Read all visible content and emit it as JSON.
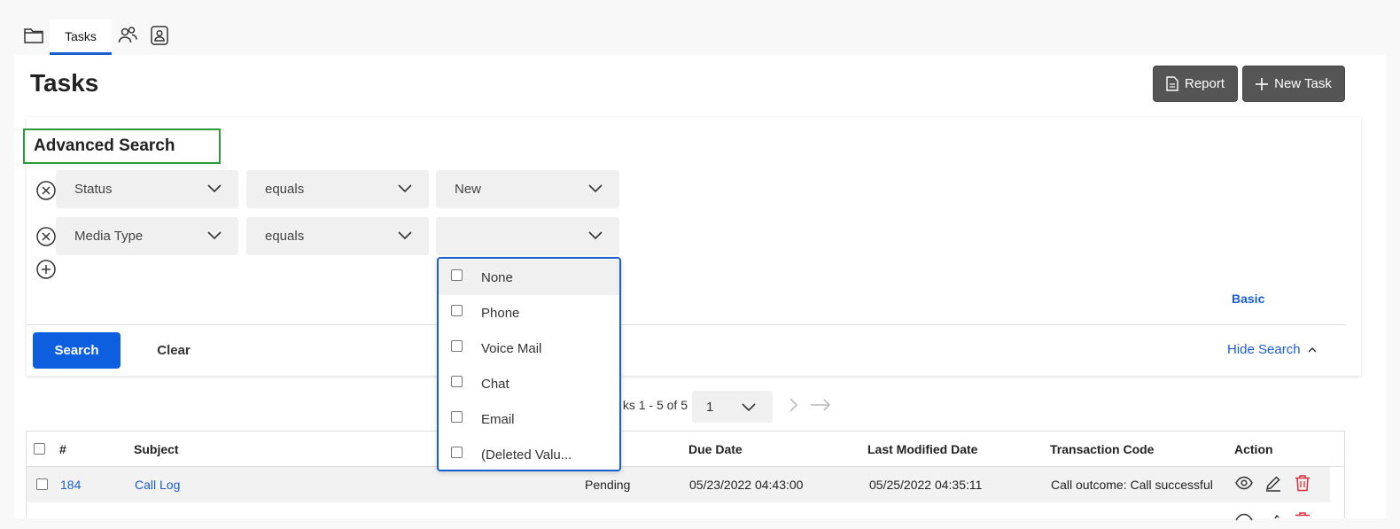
{
  "tabs": {
    "active_label": "Tasks",
    "icons": [
      "folder-icon",
      "users-icon",
      "contacts-icon"
    ]
  },
  "page": {
    "title": "Tasks",
    "report_label": "Report",
    "new_task_label": "New Task"
  },
  "advanced_search": {
    "title": "Advanced Search",
    "rows": [
      {
        "field": "Status",
        "operator": "equals",
        "value": "New"
      },
      {
        "field": "Media Type",
        "operator": "equals",
        "value": ""
      }
    ],
    "dropdown_options": [
      "None",
      "Phone",
      "Voice Mail",
      "Chat",
      "Email",
      "(Deleted Valu..."
    ],
    "basic_link": "Basic",
    "search_label": "Search",
    "clear_label": "Clear",
    "hide_search_label": "Hide Search"
  },
  "pager": {
    "summary": "ks 1 - 5 of 5",
    "page": "1"
  },
  "table": {
    "headers": {
      "num": "#",
      "subject": "Subject",
      "due_date": "Due Date",
      "last_modified": "Last Modified Date",
      "transaction_code": "Transaction Code",
      "action": "Action"
    },
    "rows": [
      {
        "num": "184",
        "subject": "Call Log",
        "status": "Pending",
        "due_date": "05/23/2022 04:43:00",
        "last_modified": "05/25/2022 04:35:11",
        "transaction_code": "Call outcome: Call successful"
      }
    ]
  },
  "colors": {
    "accent": "#1a5fd0",
    "primary_button": "#0d5fe0",
    "dark_button": "#555555",
    "highlight_border": "#2a9a3a",
    "delete": "#d9303a"
  }
}
